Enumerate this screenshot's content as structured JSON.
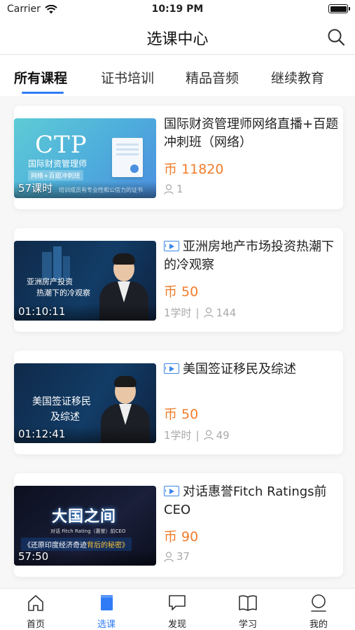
{
  "status_bar": {
    "carrier": "Carrier",
    "time": "10:19 PM"
  },
  "nav": {
    "title": "选课中心"
  },
  "tabs": [
    {
      "label": "所有课程",
      "active": true
    },
    {
      "label": "证书培训",
      "active": false
    },
    {
      "label": "精品音频",
      "active": false
    },
    {
      "label": "继续教育",
      "active": false
    }
  ],
  "courses": [
    {
      "title": "国际财资管理师网络直播+百题冲刺班（网络）",
      "is_video": false,
      "currency": "币",
      "price": "11820",
      "hours": "",
      "students": "1",
      "thumb_badge": "57课时",
      "thumb_title": "CTP",
      "thumb_subtitle": "国际财资管理师",
      "thumb_tag": "网络+百题冲刺班",
      "thumb_caption": "培训成员有专业性和公信力的证书"
    },
    {
      "title": "亚洲房地产市场投资热潮下的冷观察",
      "is_video": true,
      "currency": "币",
      "price": "50",
      "hours": "1学时",
      "students": "144",
      "thumb_badge": "01:10:11",
      "thumb_title": "亚洲房产投资",
      "thumb_subtitle": "热潮下的冷观察"
    },
    {
      "title": "美国签证移民及综述",
      "is_video": true,
      "currency": "币",
      "price": "50",
      "hours": "1学时",
      "students": "49",
      "thumb_badge": "01:12:41",
      "thumb_title": "美国签证移民",
      "thumb_subtitle": "及综述"
    },
    {
      "title": "对话惠誉Fitch Ratings前CEO",
      "is_video": true,
      "currency": "币",
      "price": "90",
      "hours": "",
      "students": "37",
      "thumb_badge": "57:50",
      "thumb_title": "大国之间",
      "thumb_tag": "对话 Fitch Rating（惠誉）前CEO",
      "thumb_subtitle": "《还原印度经济奇迹",
      "thumb_subtitle_highlight": "背后的秘密》"
    }
  ],
  "tabbar": [
    {
      "label": "首页",
      "icon": "home-icon",
      "active": false
    },
    {
      "label": "选课",
      "icon": "book-icon",
      "active": true
    },
    {
      "label": "发现",
      "icon": "chat-icon",
      "active": false
    },
    {
      "label": "学习",
      "icon": "open-book-icon",
      "active": false
    },
    {
      "label": "我的",
      "icon": "user-icon",
      "active": false
    }
  ],
  "colors": {
    "accent": "#2f7cf6",
    "price": "#f07d2b",
    "meta": "#aaaaaa"
  }
}
